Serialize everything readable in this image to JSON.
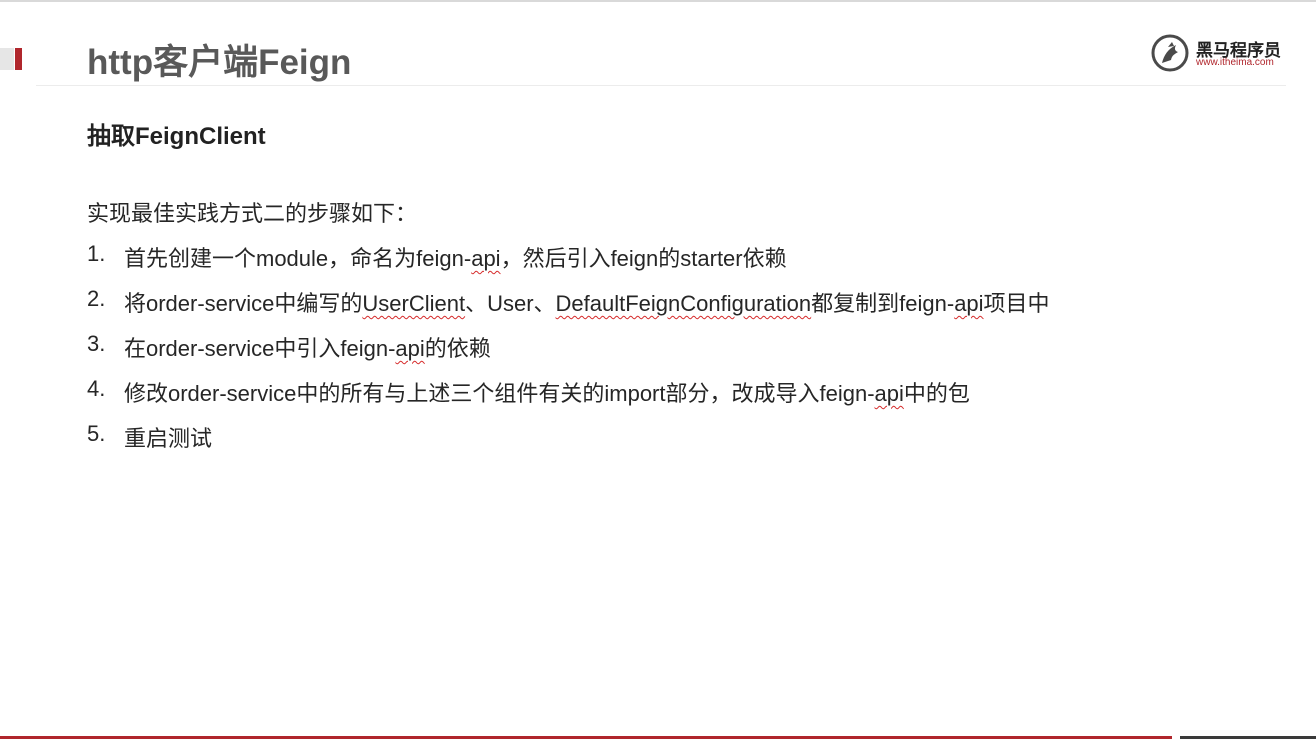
{
  "header": {
    "title": "http客户端Feign",
    "logo_cn": "黑马程序员",
    "logo_url": "www.itheima.com"
  },
  "section": {
    "title": "抽取FeignClient",
    "intro": "实现最佳实践方式二的步骤如下："
  },
  "steps": [
    {
      "num": "1.",
      "parts": [
        "首先创建一个module，命名为feign-",
        "api",
        "，然后引入feign的starter依赖"
      ]
    },
    {
      "num": "2.",
      "parts": [
        "将order-service中编写的",
        "UserClient",
        "、User、",
        "DefaultFeignConfiguration",
        "都复制到feign-",
        "api",
        "项目中"
      ]
    },
    {
      "num": "3.",
      "parts": [
        "在order-service中引入feign-",
        "api",
        "的依赖"
      ]
    },
    {
      "num": "4.",
      "parts": [
        "修改order-service中的所有与上述三个组件有关的import部分，改成导入feign-",
        "api",
        "中的包"
      ]
    },
    {
      "num": "5.",
      "parts": [
        "重启测试"
      ]
    }
  ],
  "colors": {
    "accent": "#b0262c",
    "title_text": "#595959",
    "body_text": "#262626",
    "spellcheck": "#d62a2a"
  }
}
